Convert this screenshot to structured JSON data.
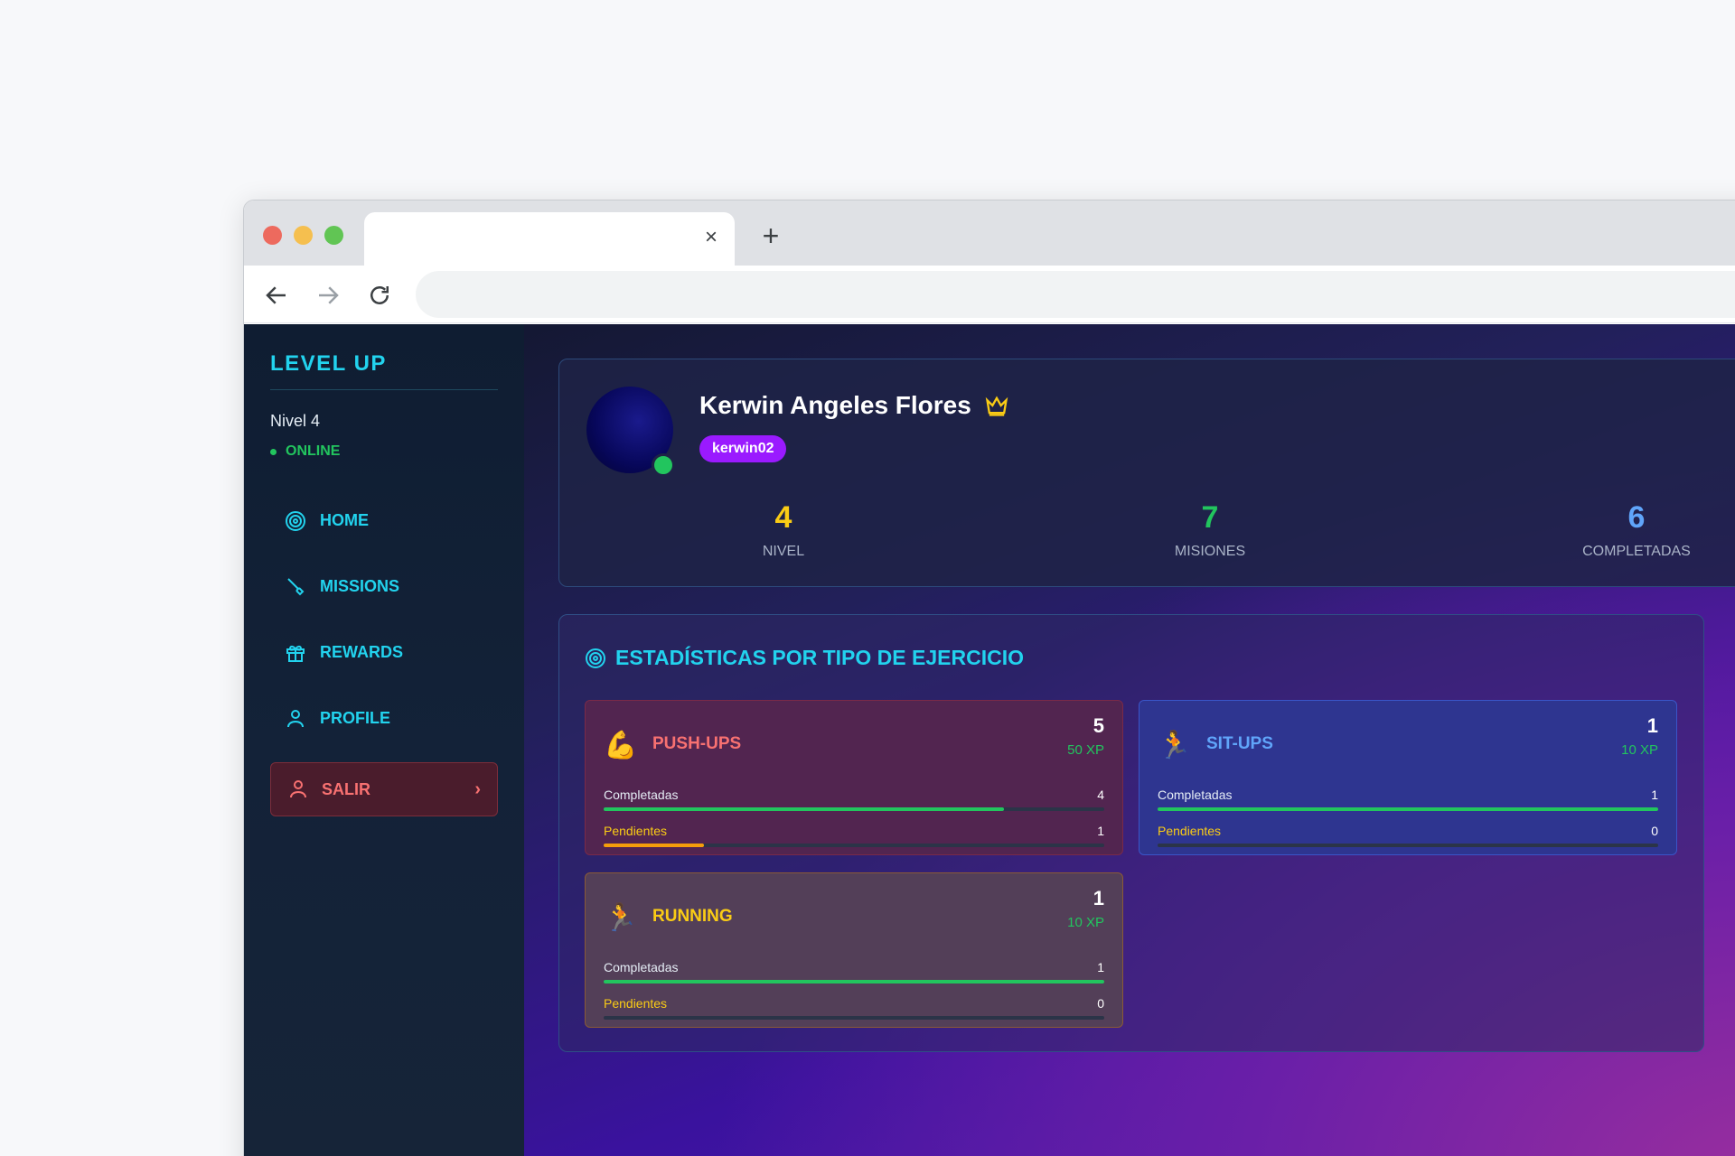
{
  "browser": {
    "tab_close": "×",
    "new_tab": "+"
  },
  "sidebar": {
    "brand": "LEVEL UP",
    "level": "Nivel 4",
    "status": "ONLINE",
    "items": [
      {
        "label": "HOME",
        "icon": "target-icon"
      },
      {
        "label": "MISSIONS",
        "icon": "sword-icon"
      },
      {
        "label": "REWARDS",
        "icon": "gift-icon"
      },
      {
        "label": "PROFILE",
        "icon": "user-icon"
      }
    ],
    "logout": {
      "label": "SALIR",
      "chevron": "›"
    }
  },
  "profile": {
    "name": "Kerwin Angeles Flores",
    "username": "kerwin02",
    "stats": [
      {
        "value": "4",
        "label": "NIVEL"
      },
      {
        "value": "7",
        "label": "MISIONES"
      },
      {
        "value": "6",
        "label": "COMPLETADAS"
      }
    ]
  },
  "exercise_stats": {
    "title": "ESTADÍSTICAS POR TIPO DE EJERCICIO",
    "cards": [
      {
        "emoji": "💪",
        "name": "PUSH-UPS",
        "count": "5",
        "xp": "50 XP",
        "completed_label": "Completadas",
        "completed": "4",
        "pending_label": "Pendientes",
        "pending": "1",
        "completed_fraction": 0.8,
        "pending_fraction": 0.2
      },
      {
        "emoji": "🏃",
        "name": "SIT-UPS",
        "count": "1",
        "xp": "10 XP",
        "completed_label": "Completadas",
        "completed": "1",
        "pending_label": "Pendientes",
        "pending": "0",
        "completed_fraction": 1.0,
        "pending_fraction": 0.0
      },
      {
        "emoji": "🏃",
        "name": "RUNNING",
        "count": "1",
        "xp": "10 XP",
        "completed_label": "Completadas",
        "completed": "1",
        "pending_label": "Pendientes",
        "pending": "0",
        "completed_fraction": 1.0,
        "pending_fraction": 0.0
      }
    ]
  },
  "colors": {
    "accent": "#22d3ee",
    "online": "#22c55e",
    "level": "#facc15",
    "missions": "#22c55e",
    "completed": "#60a5fa",
    "badge": "#9a1aff",
    "logout": "#f87171"
  }
}
